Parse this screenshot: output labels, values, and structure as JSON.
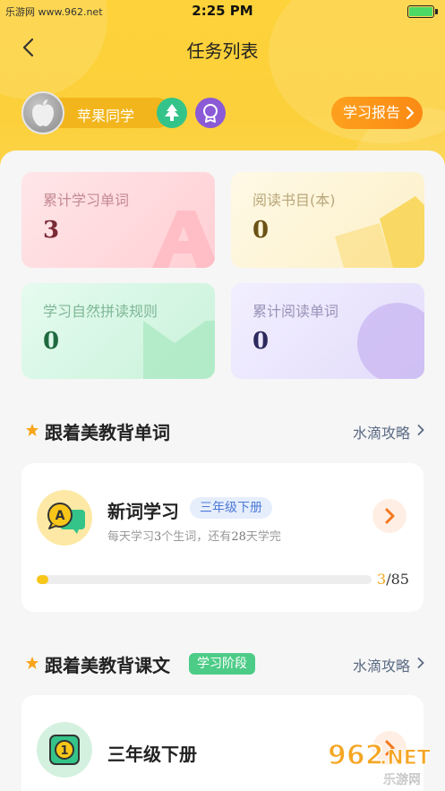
{
  "status_bar": {
    "site": "乐游网 www.962.net",
    "time": "2:25 PM"
  },
  "nav": {
    "title": "任务列表"
  },
  "profile": {
    "name": "苹果同学",
    "report_label": "学习报告"
  },
  "stats": [
    {
      "label": "累计学习单词",
      "value": "3"
    },
    {
      "label": "阅读书目(本)",
      "value": "0"
    },
    {
      "label": "学习自然拼读规则",
      "value": "0"
    },
    {
      "label": "累计阅读单词",
      "value": "0"
    }
  ],
  "section_words": {
    "title": "跟着美教背单词",
    "tips_label": "水滴攻略",
    "card": {
      "title": "新词学习",
      "grade_tag": "三年级下册",
      "desc_prefix": "每天学习",
      "per_day": "3",
      "desc_mid": "个生词，还有",
      "days_left": "28",
      "desc_suffix": "天学完",
      "progress_done": "3",
      "progress_total": "/85",
      "progress_fraction": 0.035
    }
  },
  "section_texts": {
    "title": "跟着美教背课文",
    "stage_tag": "学习阶段",
    "tips_label": "水滴攻略",
    "card": {
      "title": "三年级下册"
    }
  },
  "watermark": {
    "brand": "962",
    "suffix": ".NET",
    "site": "乐游网"
  },
  "colors": {
    "header": "#fcd03a",
    "report_button": "#fb8a14",
    "stage_tag": "#4dcc87",
    "grade_tag_text": "#4d79d6",
    "progress": "#f7c619"
  }
}
